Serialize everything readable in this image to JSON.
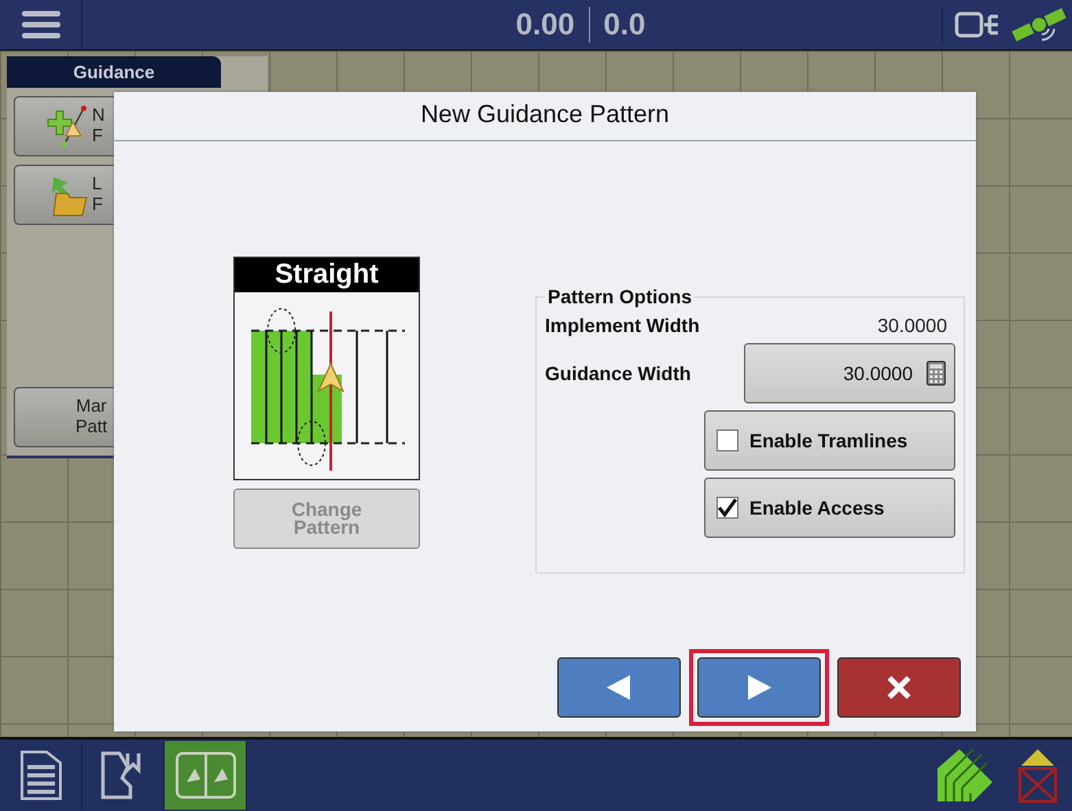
{
  "top_bar": {
    "readings": [
      "0.00",
      "0.0"
    ]
  },
  "side_panel": {
    "title": "Guidance",
    "buttons": [
      {
        "kind": "new",
        "lines": [
          "N",
          "F"
        ]
      },
      {
        "kind": "load",
        "lines": [
          "L",
          "F"
        ]
      },
      {
        "kind": "manage",
        "lines": [
          "Mar",
          "Patt"
        ]
      }
    ]
  },
  "dialog": {
    "title": "New Guidance Pattern",
    "pattern": {
      "name": "Straight",
      "change_button": {
        "label": "Change Pattern",
        "disabled": true
      }
    },
    "options": {
      "title": "Pattern Options",
      "implement_width": {
        "label": "Implement Width",
        "value": "30.0000"
      },
      "guidance_width": {
        "label": "Guidance Width",
        "value": "30.0000"
      },
      "toggles": [
        {
          "label": "Enable Tramlines",
          "checked": false
        },
        {
          "label": "Enable Access",
          "checked": true
        }
      ]
    },
    "nav_buttons": [
      {
        "kind": "back",
        "highlighted": false
      },
      {
        "kind": "next",
        "highlighted": true
      },
      {
        "kind": "cancel",
        "highlighted": false
      }
    ]
  },
  "bottom_bar": {
    "tabs": [
      {
        "kind": "document",
        "selected": false
      },
      {
        "kind": "map",
        "selected": false
      },
      {
        "kind": "split",
        "selected": true
      }
    ]
  }
}
